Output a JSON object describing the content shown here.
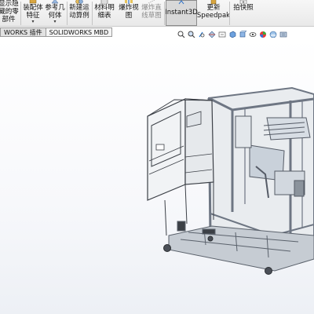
{
  "toolbar": {
    "items": [
      {
        "label": "显示隐\n藏的零\n部件",
        "icon": "show-hidden-icon"
      },
      {
        "label": "装配体\n特征",
        "icon": "assembly-feature-icon"
      },
      {
        "label": "参考几\n何体",
        "icon": "reference-geometry-icon"
      },
      {
        "label": "新建运\n动算例",
        "icon": "new-motion-study-icon"
      },
      {
        "label": "材料明\n细表",
        "icon": "bom-icon"
      },
      {
        "label": "爆炸视\n图",
        "icon": "exploded-view-icon"
      },
      {
        "label": "爆炸直\n线草图",
        "icon": "explode-line-sketch-icon"
      },
      {
        "label": "Instant3D",
        "icon": "instant3d-icon"
      },
      {
        "label": "更新\nSpeedpak",
        "icon": "update-speedpak-icon"
      },
      {
        "label": "拍快照",
        "icon": "snapshot-icon"
      }
    ]
  },
  "tabs": [
    "WORKS 插件",
    "SOLIDWORKS MBD"
  ],
  "view_toolbar": [
    "zoom-to-fit-icon",
    "zoom-area-icon",
    "previous-view-icon",
    "section-view-icon",
    "dynamic-annotation-icon",
    "view-orientation-icon",
    "display-style-icon",
    "hide-show-items-icon",
    "edit-appearance-icon",
    "apply-scene-icon",
    "view-settings-icon"
  ],
  "colors": {
    "frame": "#6e7683",
    "panel": "#e8ecef",
    "ribbon": "#eeeeee",
    "selected": "#d8d8d8"
  }
}
